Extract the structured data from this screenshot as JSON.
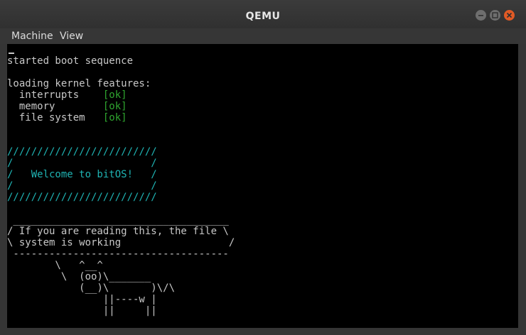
{
  "window": {
    "title": "QEMU"
  },
  "menubar": {
    "items": [
      {
        "label": "Machine"
      },
      {
        "label": "View"
      }
    ]
  },
  "icons": {
    "minimize": "minimize-icon",
    "maximize": "maximize-icon",
    "close": "close-icon"
  },
  "colors": {
    "ok": "#2fa52f",
    "banner": "#1fb3b3",
    "text": "#c8c8c8",
    "close_button": "#e05a25"
  },
  "console": {
    "boot": "started boot sequence",
    "loading": "loading kernel features:",
    "features": [
      {
        "name": "  interrupts    ",
        "status": "[ok]"
      },
      {
        "name": "  memory        ",
        "status": "[ok]"
      },
      {
        "name": "  file system   ",
        "status": "[ok]"
      }
    ],
    "banner": [
      "/////////////////////////",
      "/                       /",
      "/   Welcome to bitOS!   /",
      "/                       /",
      "/////////////////////////"
    ],
    "cowsay": [
      " ____________________________________",
      "/ If you are reading this, the file \\",
      "\\ system is working                  /",
      " ------------------------------------",
      "        \\   ^__^",
      "         \\  (oo)\\_______",
      "            (__)\\       )\\/\\",
      "                ||----w |",
      "                ||     ||"
    ]
  }
}
